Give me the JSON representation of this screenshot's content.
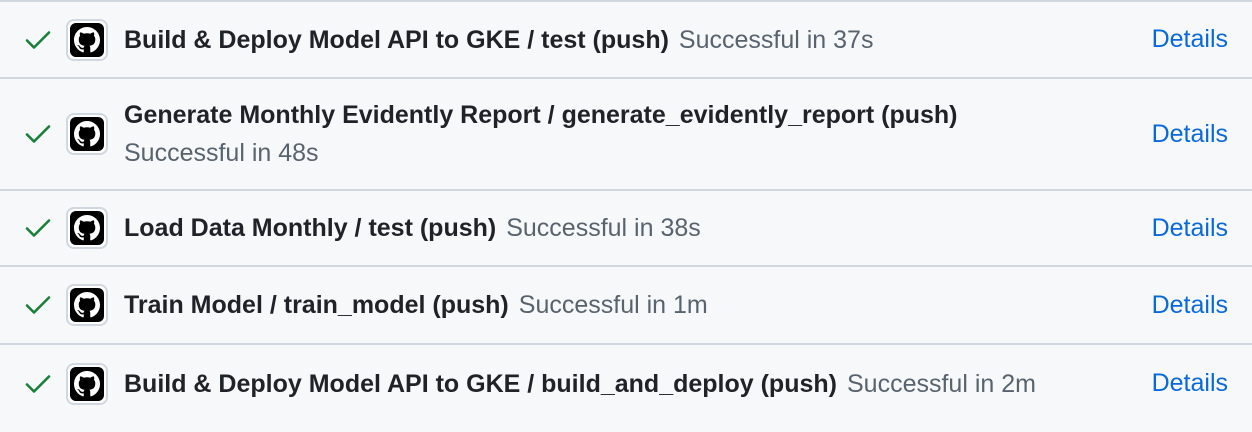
{
  "checks": [
    {
      "name": "Build & Deploy Model API to GKE / test (push)",
      "status": "Successful in 37s",
      "details_label": "Details"
    },
    {
      "name": "Generate Monthly Evidently Report / generate_evidently_report (push)",
      "status": "Successful in 48s",
      "details_label": "Details"
    },
    {
      "name": "Load Data Monthly / test (push)",
      "status": "Successful in 38s",
      "details_label": "Details"
    },
    {
      "name": "Train Model / train_model (push)",
      "status": "Successful in 1m",
      "details_label": "Details"
    },
    {
      "name": "Build & Deploy Model API to GKE / build_and_deploy (push)",
      "status": "Successful in 2m",
      "details_label": "Details"
    }
  ],
  "icons": {
    "status": "check-icon",
    "app": "github-icon"
  },
  "colors": {
    "success": "#1a7f37",
    "link": "#0969da",
    "text": "#1f2328",
    "muted": "#59636e",
    "border": "#d0d7de",
    "background": "#f6f8fa"
  }
}
